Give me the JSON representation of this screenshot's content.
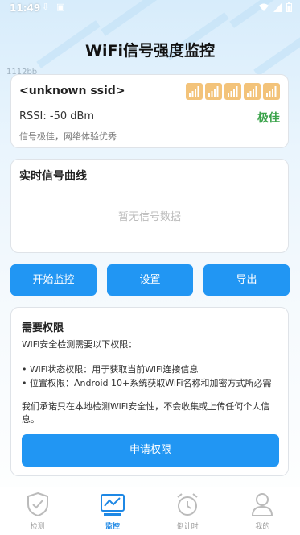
{
  "status_bar": {
    "time": "11:49"
  },
  "header": {
    "title": "WiFi信号强度监控",
    "watermark": "1112bb"
  },
  "wifi_card": {
    "ssid": "<unknown ssid>",
    "rssi": "RSSI: -50 dBm",
    "quality": "极佳",
    "description": "信号极佳，网络体验优秀",
    "signal_bars": 5,
    "accent_color": "#3aa34a"
  },
  "chart_card": {
    "title": "实时信号曲线",
    "empty_text": "暂无信号数据"
  },
  "actions": {
    "start": "开始监控",
    "settings": "设置",
    "export": "导出"
  },
  "permissions": {
    "title": "需要权限",
    "intro": "WiFi安全检测需要以下权限：",
    "item1": "• WiFi状态权限：用于获取当前WiFi连接信息",
    "item2": "• 位置权限：Android 10+系统获取WiFi名称和加密方式所必需",
    "promise": "我们承诺只在本地检测WiFi安全性，不会收集或上传任何个人信息。",
    "button": "申请权限"
  },
  "tabs": [
    {
      "label": "检测",
      "icon": "shield-check-icon",
      "active": false
    },
    {
      "label": "监控",
      "icon": "monitor-chart-icon",
      "active": true
    },
    {
      "label": "倒计时",
      "icon": "alarm-clock-icon",
      "active": false
    },
    {
      "label": "我的",
      "icon": "user-icon",
      "active": false
    }
  ],
  "colors": {
    "primary": "#2196f3",
    "tab_active": "#1e88e5",
    "signal_tile": "#f3c37a"
  }
}
